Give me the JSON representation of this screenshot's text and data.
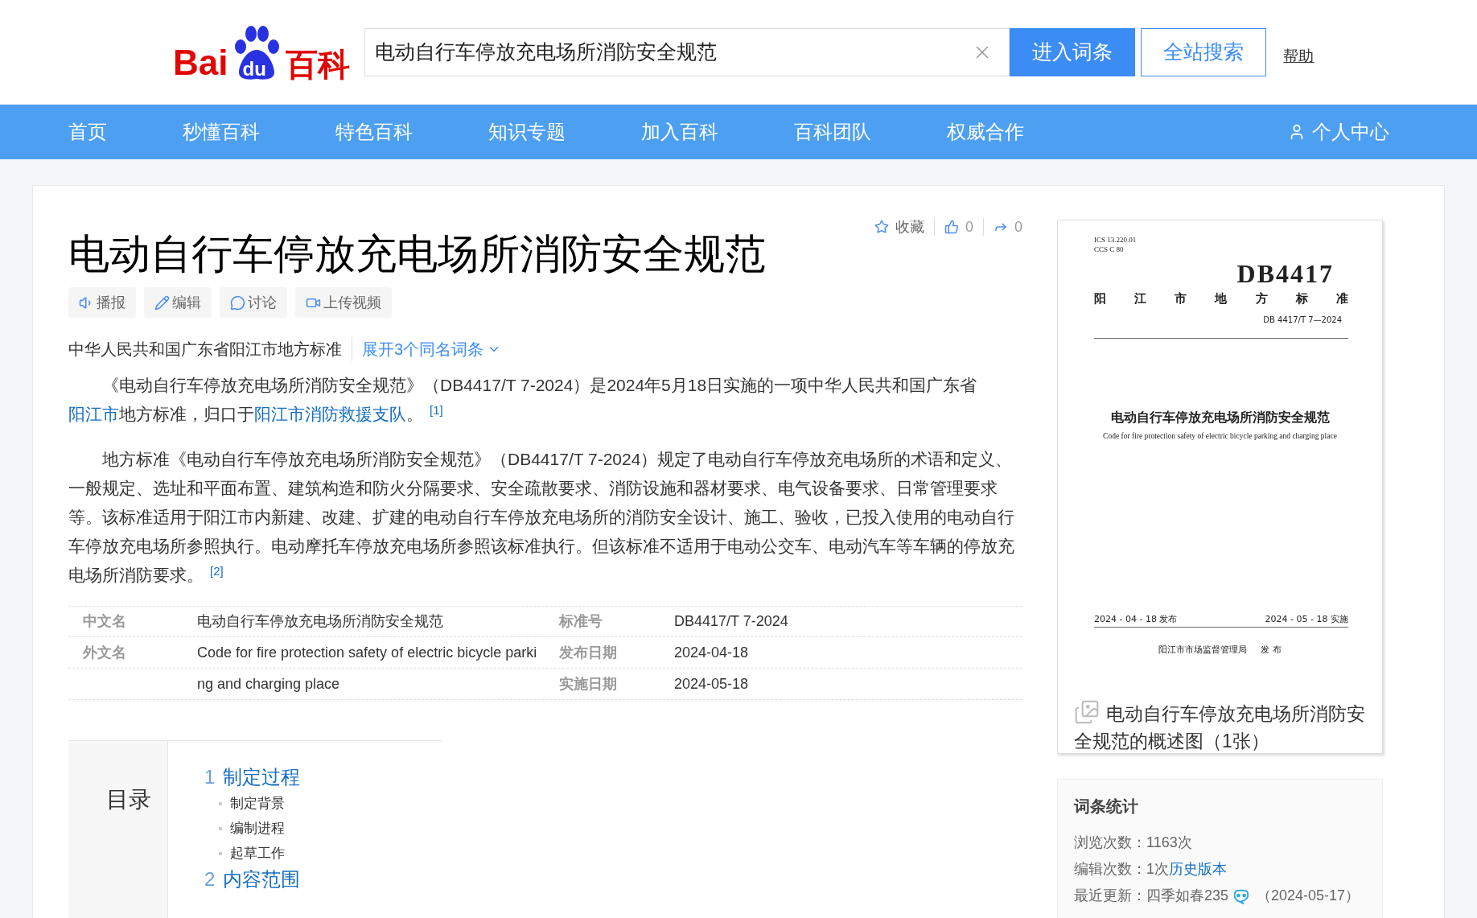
{
  "logo": {
    "part1": "Bai",
    "part2": "du",
    "part3": "百科"
  },
  "search": {
    "value": "电动自行车停放充电场所消防安全规范",
    "buttons": [
      "进入词条",
      "全站搜索"
    ],
    "help": "帮助"
  },
  "nav": {
    "items": [
      "首页",
      "秒懂百科",
      "特色百科",
      "知识专题",
      "加入百科",
      "百科团队",
      "权威合作"
    ],
    "user": "个人中心"
  },
  "article": {
    "actions": [
      {
        "kind": "star",
        "label": "收藏"
      },
      {
        "kind": "like",
        "label": "0"
      },
      {
        "kind": "share",
        "label": "0"
      }
    ],
    "title": "电动自行车停放充电场所消防安全规范",
    "tools": [
      {
        "kind": "speaker",
        "label": "播报"
      },
      {
        "kind": "edit",
        "label": "编辑"
      },
      {
        "kind": "discuss",
        "label": "讨论"
      },
      {
        "kind": "video",
        "label": "上传视频"
      }
    ],
    "subtitle": "中华人民共和国广东省阳江市地方标准",
    "same_name": "展开3个同名词条",
    "paragraphs": [
      [
        {
          "kind": "text",
          "text": "《电动自行车停放充电场所消防安全规范》（DB4417/T 7-2024）是2024年5月18日实施的一项中华人民共和国广东省"
        },
        {
          "kind": "link",
          "text": "阳江市"
        },
        {
          "kind": "text",
          "text": "地方标准，归口于"
        },
        {
          "kind": "link",
          "text": "阳江市消防救援支队"
        },
        {
          "kind": "text",
          "text": "。"
        },
        {
          "kind": "ref",
          "text": "[1]"
        }
      ],
      [
        {
          "kind": "text",
          "text": "地方标准《电动自行车停放充电场所消防安全规范》（DB4417/T 7-2024）规定了电动自行车停放充电场所的术语和定义、一般规定、选址和平面布置、建筑构造和防火分隔要求、安全疏散要求、消防设施和器材要求、电气设备要求、日常管理要求等。该标准适用于阳江市内新建、改建、扩建的电动自行车停放充电场所的消防安全设计、施工、验收，已投入使用的电动自行车停放充电场所参照执行。电动摩托车停放充电场所参照该标准执行。但该标准不适用于电动公交车、电动汽车等车辆的停放充电场所消防要求。"
        },
        {
          "kind": "ref",
          "text": "[2]"
        }
      ]
    ],
    "info_rows": [
      {
        "left_label": "中文名",
        "left_value": "电动自行车停放充电场所消防安全规范",
        "right_label": "标准号",
        "right_value": "DB4417/T 7-2024"
      },
      {
        "left_label": "外文名",
        "left_value": "Code for fire protection safety of electric bicycle parki",
        "right_label": "发布日期",
        "right_value": "2024-04-18"
      },
      {
        "left_value": "ng and charging place",
        "right_label": "实施日期",
        "right_value": "2024-05-18"
      }
    ],
    "toc": {
      "title": "目录",
      "sections": [
        {
          "number": "1",
          "title": "制定过程",
          "children": [
            "制定背景",
            "编制进程",
            "起草工作"
          ]
        },
        {
          "number": "2",
          "title": "内容范围"
        }
      ]
    }
  },
  "cover": {
    "ics": "ICS  13.220.01",
    "ccs": "CCS  C 80",
    "code": "DB4417",
    "kind_label": "阳江市地方标准",
    "number": "DB 4417/T  7—2024",
    "title": "电动自行车停放充电场所消防安全规范",
    "english": "Code for fire protection safety of electric bicycle parking and charging place",
    "issued": "2024 - 04 - 18 发布",
    "effective": "2024 - 05 - 18 实施",
    "issuer": "阳江市市场监督管理局     发 布",
    "caption": "电动自行车停放充电场所消防安全规范的概述图（1张）"
  },
  "stats": {
    "title": "词条统计",
    "lines": [
      {
        "label": "浏览次数：",
        "value": "1163次"
      },
      {
        "label": "编辑次数：",
        "value": "1次",
        "link": "历史版本"
      },
      {
        "label": "最近更新：",
        "value": "四季如春235",
        "badge": true,
        "date": "（2024-05-17）"
      }
    ]
  }
}
